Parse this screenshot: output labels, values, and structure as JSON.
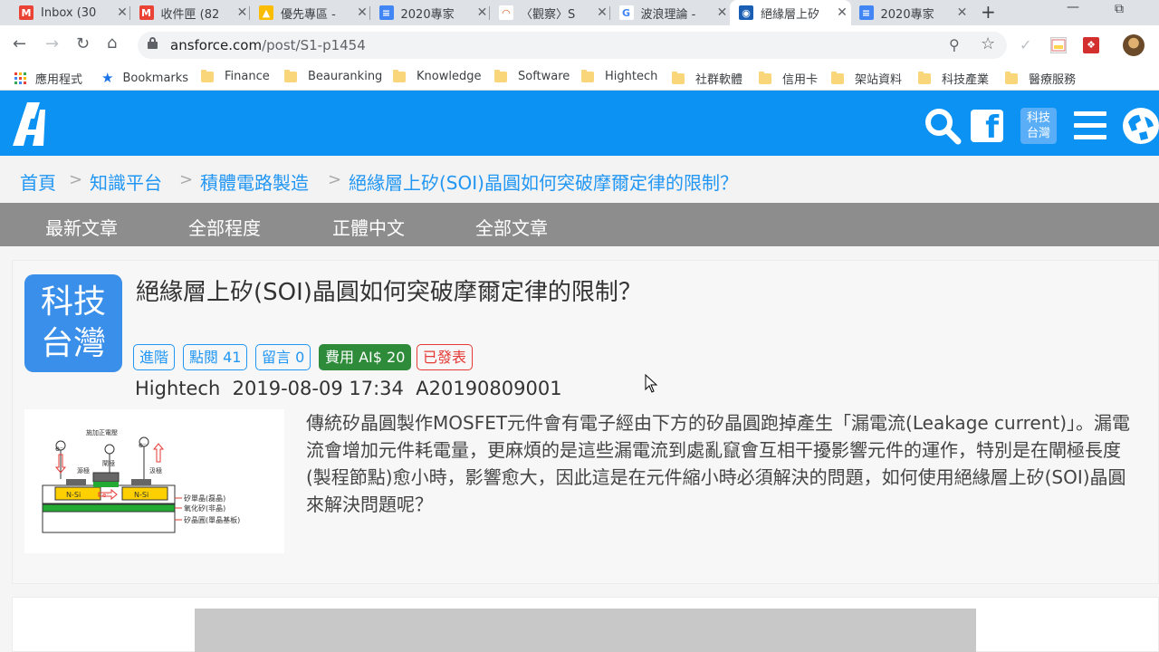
{
  "browser": {
    "tabs": [
      {
        "title": "Inbox (30",
        "icon": "gmail-icon",
        "active": false
      },
      {
        "title": "收件匣 (82",
        "icon": "gmail-icon",
        "active": false
      },
      {
        "title": "優先專區 -",
        "icon": "drive-icon",
        "active": false
      },
      {
        "title": "2020專家",
        "icon": "docs-icon",
        "active": false
      },
      {
        "title": "〈觀察〉S",
        "icon": "rainbow-icon",
        "active": false
      },
      {
        "title": "波浪理論 -",
        "icon": "google-icon",
        "active": false
      },
      {
        "title": "絕緣層上矽",
        "icon": "rss-icon",
        "active": true
      },
      {
        "title": "2020專家",
        "icon": "docs-icon",
        "active": false
      }
    ],
    "new_tab_glyph": "+",
    "url_host": "ansforce.com",
    "url_path": "/post/S1-p1454",
    "bookmarks": [
      {
        "label": "應用程式",
        "type": "apps"
      },
      {
        "label": "Bookmarks",
        "type": "star"
      },
      {
        "label": "Finance",
        "type": "folder"
      },
      {
        "label": "Beauranking",
        "type": "folder"
      },
      {
        "label": "Knowledge",
        "type": "folder"
      },
      {
        "label": "Software",
        "type": "folder"
      },
      {
        "label": "Hightech",
        "type": "folder"
      },
      {
        "label": "社群軟體",
        "type": "folder"
      },
      {
        "label": "信用卡",
        "type": "folder"
      },
      {
        "label": "架站資料",
        "type": "folder"
      },
      {
        "label": "科技產業",
        "type": "folder"
      },
      {
        "label": "醫療服務",
        "type": "folder"
      }
    ]
  },
  "site": {
    "brand_color": "#0b92f3",
    "header_badge_line1": "科技",
    "header_badge_line2": "台灣",
    "breadcrumb": [
      "首頁",
      "知識平台",
      "積體電路製造",
      "絕緣層上矽(SOI)晶圓如何突破摩爾定律的限制？"
    ],
    "breadcrumb_sep": ">",
    "nav": [
      "最新文章",
      "全部程度",
      "正體中文",
      "全部文章"
    ]
  },
  "article": {
    "avatar_line1": "科技",
    "avatar_line2": "台灣",
    "title": "絕緣層上矽(SOI)晶圓如何突破摩爾定律的限制？",
    "tags": [
      "進階",
      "點閱 41",
      "留言 0",
      "費用 AI$ 20",
      "已發表"
    ],
    "category": "Hightech",
    "datetime": "2019-08-09 17:34",
    "article_id": "A20190809001",
    "excerpt": "傳統矽晶圓製作MOSFET元件會有電子經由下方的矽晶圓跑掉產生「漏電流(Leakage current)」。漏電流會增加元件耗電量，更麻煩的是這些漏電流到處亂竄會互相干擾影響元件的運作，特別是在閘極長度(製程節點)愈小時，影響愈大，因此這是在元件縮小時必須解決的問題，如何使用絕緣層上矽(SOI)晶圓來解決問題呢？",
    "diagram": {
      "top_label": "施加正電壓",
      "source_label": "源極",
      "gate_label": "閘極",
      "drain_label": "汲極",
      "nsi_left": "N-Si",
      "nsi_right": "N-Si",
      "electron": "e⁻",
      "electron_left": "e⁻",
      "electron_right": "e⁻",
      "layer1": "矽單晶(磊晶)",
      "layer2": "氧化矽(非晶)",
      "layer3": "矽晶圓(單晶基板)"
    }
  }
}
